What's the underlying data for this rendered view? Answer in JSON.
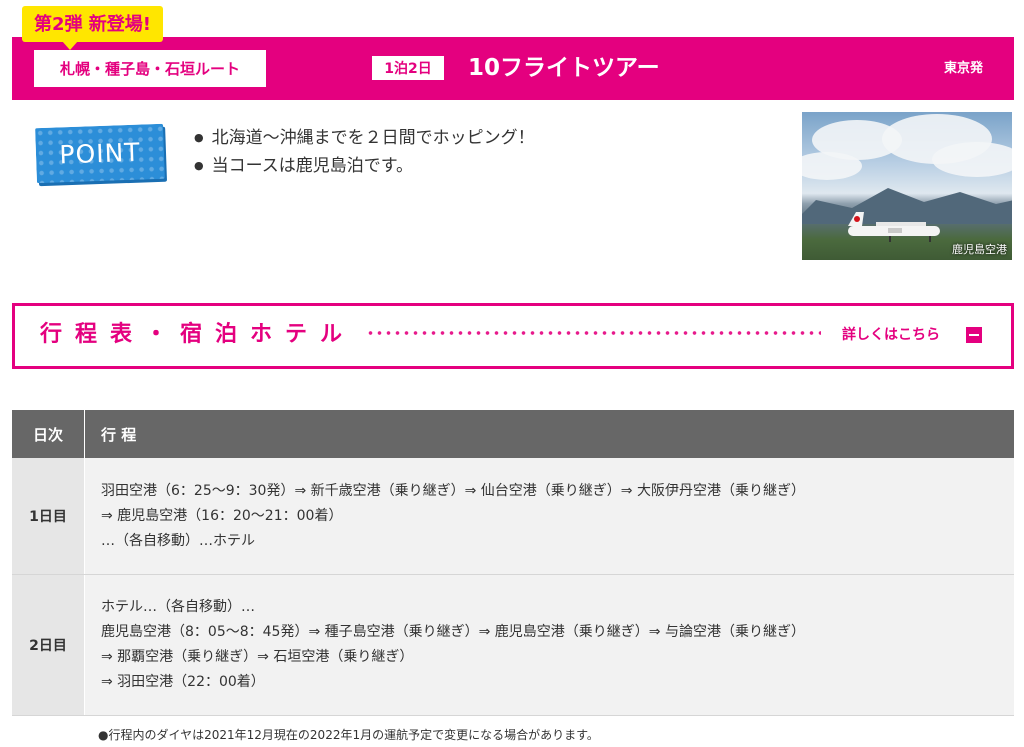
{
  "header": {
    "badge": "第2弾 新登場!",
    "route": "札幌・種子島・石垣ルート",
    "nights": "1泊2日",
    "tour_name": "10フライトツアー",
    "origin": "東京発",
    "accent_color": "#e4007f",
    "badge_color": "#ffe600"
  },
  "point": {
    "label": "POINT",
    "items": [
      "北海道〜沖縄までを２日間でホッピング！",
      "当コースは鹿児島泊です。"
    ]
  },
  "photo": {
    "caption": "鹿児島空港"
  },
  "itinerary": {
    "title": "行程表・宿泊ホテル",
    "details_link": "詳しくはこちら",
    "toggle_icon": "minus-square-icon"
  },
  "table": {
    "headers": {
      "day": "日次",
      "schedule": "行 程"
    },
    "rows": [
      {
        "day": "1日目",
        "lines": [
          "羽田空港（6：25〜9：30発）⇒ 新千歳空港（乗り継ぎ）⇒ 仙台空港（乗り継ぎ）⇒ 大阪伊丹空港（乗り継ぎ）",
          "⇒ 鹿児島空港（16：20〜21：00着）",
          "…（各自移動）…ホテル"
        ]
      },
      {
        "day": "2日目",
        "lines": [
          "ホテル…（各自移動）…",
          "鹿児島空港（8：05〜8：45発）⇒ 種子島空港（乗り継ぎ）⇒ 鹿児島空港（乗り継ぎ）⇒ 与論空港（乗り継ぎ）",
          "⇒ 那覇空港（乗り継ぎ）⇒ 石垣空港（乗り継ぎ）",
          "⇒ 羽田空港（22：00着）"
        ]
      }
    ]
  },
  "note": "●行程内のダイヤは2021年12月現在の2022年1月の運航予定で変更になる場合があります。"
}
